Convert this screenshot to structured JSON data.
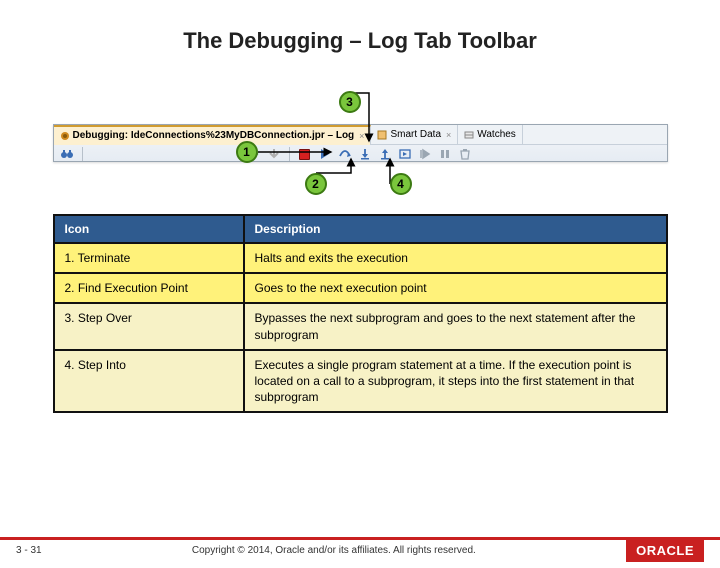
{
  "title": "The Debugging – Log Tab Toolbar",
  "callouts": {
    "c1": "1",
    "c2": "2",
    "c3": "3",
    "c4": "4"
  },
  "tabs": {
    "log": "Debugging: IdeConnections%23MyDBConnection.jpr – Log",
    "smart": "Smart Data",
    "watches": "Watches"
  },
  "table": {
    "headers": {
      "icon": "Icon",
      "desc": "Description"
    },
    "rows": [
      {
        "icon": "1. Terminate",
        "desc": "Halts and exits the execution"
      },
      {
        "icon": "2.  Find Execution Point",
        "desc": "Goes to the next execution point"
      },
      {
        "icon": "3.  Step Over",
        "desc": "Bypasses the next subprogram and goes to the next statement after the subprogram"
      },
      {
        "icon": "4.  Step Into",
        "desc": "Executes a single program statement at a time. If the execution point is located on a call to a subprogram, it steps into the first statement in that subprogram"
      }
    ]
  },
  "footer": {
    "page": "3 - 31",
    "copyright": "Copyright © 2014, Oracle and/or its affiliates. All rights reserved.",
    "brand": "ORACLE"
  }
}
